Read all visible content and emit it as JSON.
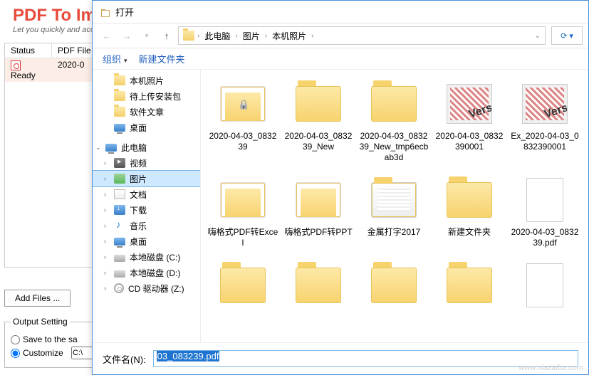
{
  "bg": {
    "title": "PDF To Im",
    "subtitle": "Let you quickly and acc",
    "cols": {
      "status": "Status",
      "file": "PDF File"
    },
    "row": {
      "status": "Ready",
      "file": "2020-0"
    },
    "add_btn": "Add Files ...",
    "fieldset": "Output Setting",
    "opt_save": "Save to the sa",
    "opt_custom": "Customize",
    "path": "C:\\"
  },
  "dialog": {
    "title": "打开",
    "breadcrumb": [
      "此电脑",
      "图片",
      "本机照片"
    ],
    "cmd_org": "组织",
    "cmd_new": "新建文件夹",
    "tree_quick": [
      {
        "label": "本机照片",
        "ico": "folder"
      },
      {
        "label": "待上传安装包",
        "ico": "folder"
      },
      {
        "label": "软件文章",
        "ico": "folder"
      },
      {
        "label": "桌面",
        "ico": "monitor"
      }
    ],
    "tree_pc_label": "此电脑",
    "tree_pc": [
      {
        "label": "视频",
        "ico": "video"
      },
      {
        "label": "图片",
        "ico": "pic",
        "sel": true
      },
      {
        "label": "文档",
        "ico": "doc"
      },
      {
        "label": "下载",
        "ico": "down"
      },
      {
        "label": "音乐",
        "ico": "music"
      },
      {
        "label": "桌面",
        "ico": "monitor"
      },
      {
        "label": "本地磁盘 (C:)",
        "ico": "drive"
      },
      {
        "label": "本地磁盘 (D:)",
        "ico": "drive"
      },
      {
        "label": "CD 驱动器 (Z:)",
        "ico": "cd"
      }
    ],
    "files": [
      {
        "name": "2020-04-03_083239",
        "t": "folder-paper-locked"
      },
      {
        "name": "2020-04-03_083239_New",
        "t": "folder"
      },
      {
        "name": "2020-04-03_083239_New_tmp6ecbab3d",
        "t": "folder"
      },
      {
        "name": "2020-04-03_0832390001",
        "t": "image"
      },
      {
        "name": "Ex_2020-04-03_0832390001",
        "t": "image"
      },
      {
        "name": "嗨格式PDF转Excel",
        "t": "folder-paper"
      },
      {
        "name": "嗨格式PDF转PPT",
        "t": "folder-paper"
      },
      {
        "name": "金属打字2017",
        "t": "folder-mixed"
      },
      {
        "name": "新建文件夹",
        "t": "folder"
      },
      {
        "name": "2020-04-03_083239.pdf",
        "t": "page"
      },
      {
        "name": "",
        "t": "folder"
      },
      {
        "name": "",
        "t": "folder"
      },
      {
        "name": "",
        "t": "folder"
      },
      {
        "name": "",
        "t": "folder"
      },
      {
        "name": "",
        "t": "page"
      }
    ],
    "fn_label": "文件名(N):",
    "fn_value": "03_083239.pdf"
  },
  "watermark": "www.xiazaiba.com"
}
